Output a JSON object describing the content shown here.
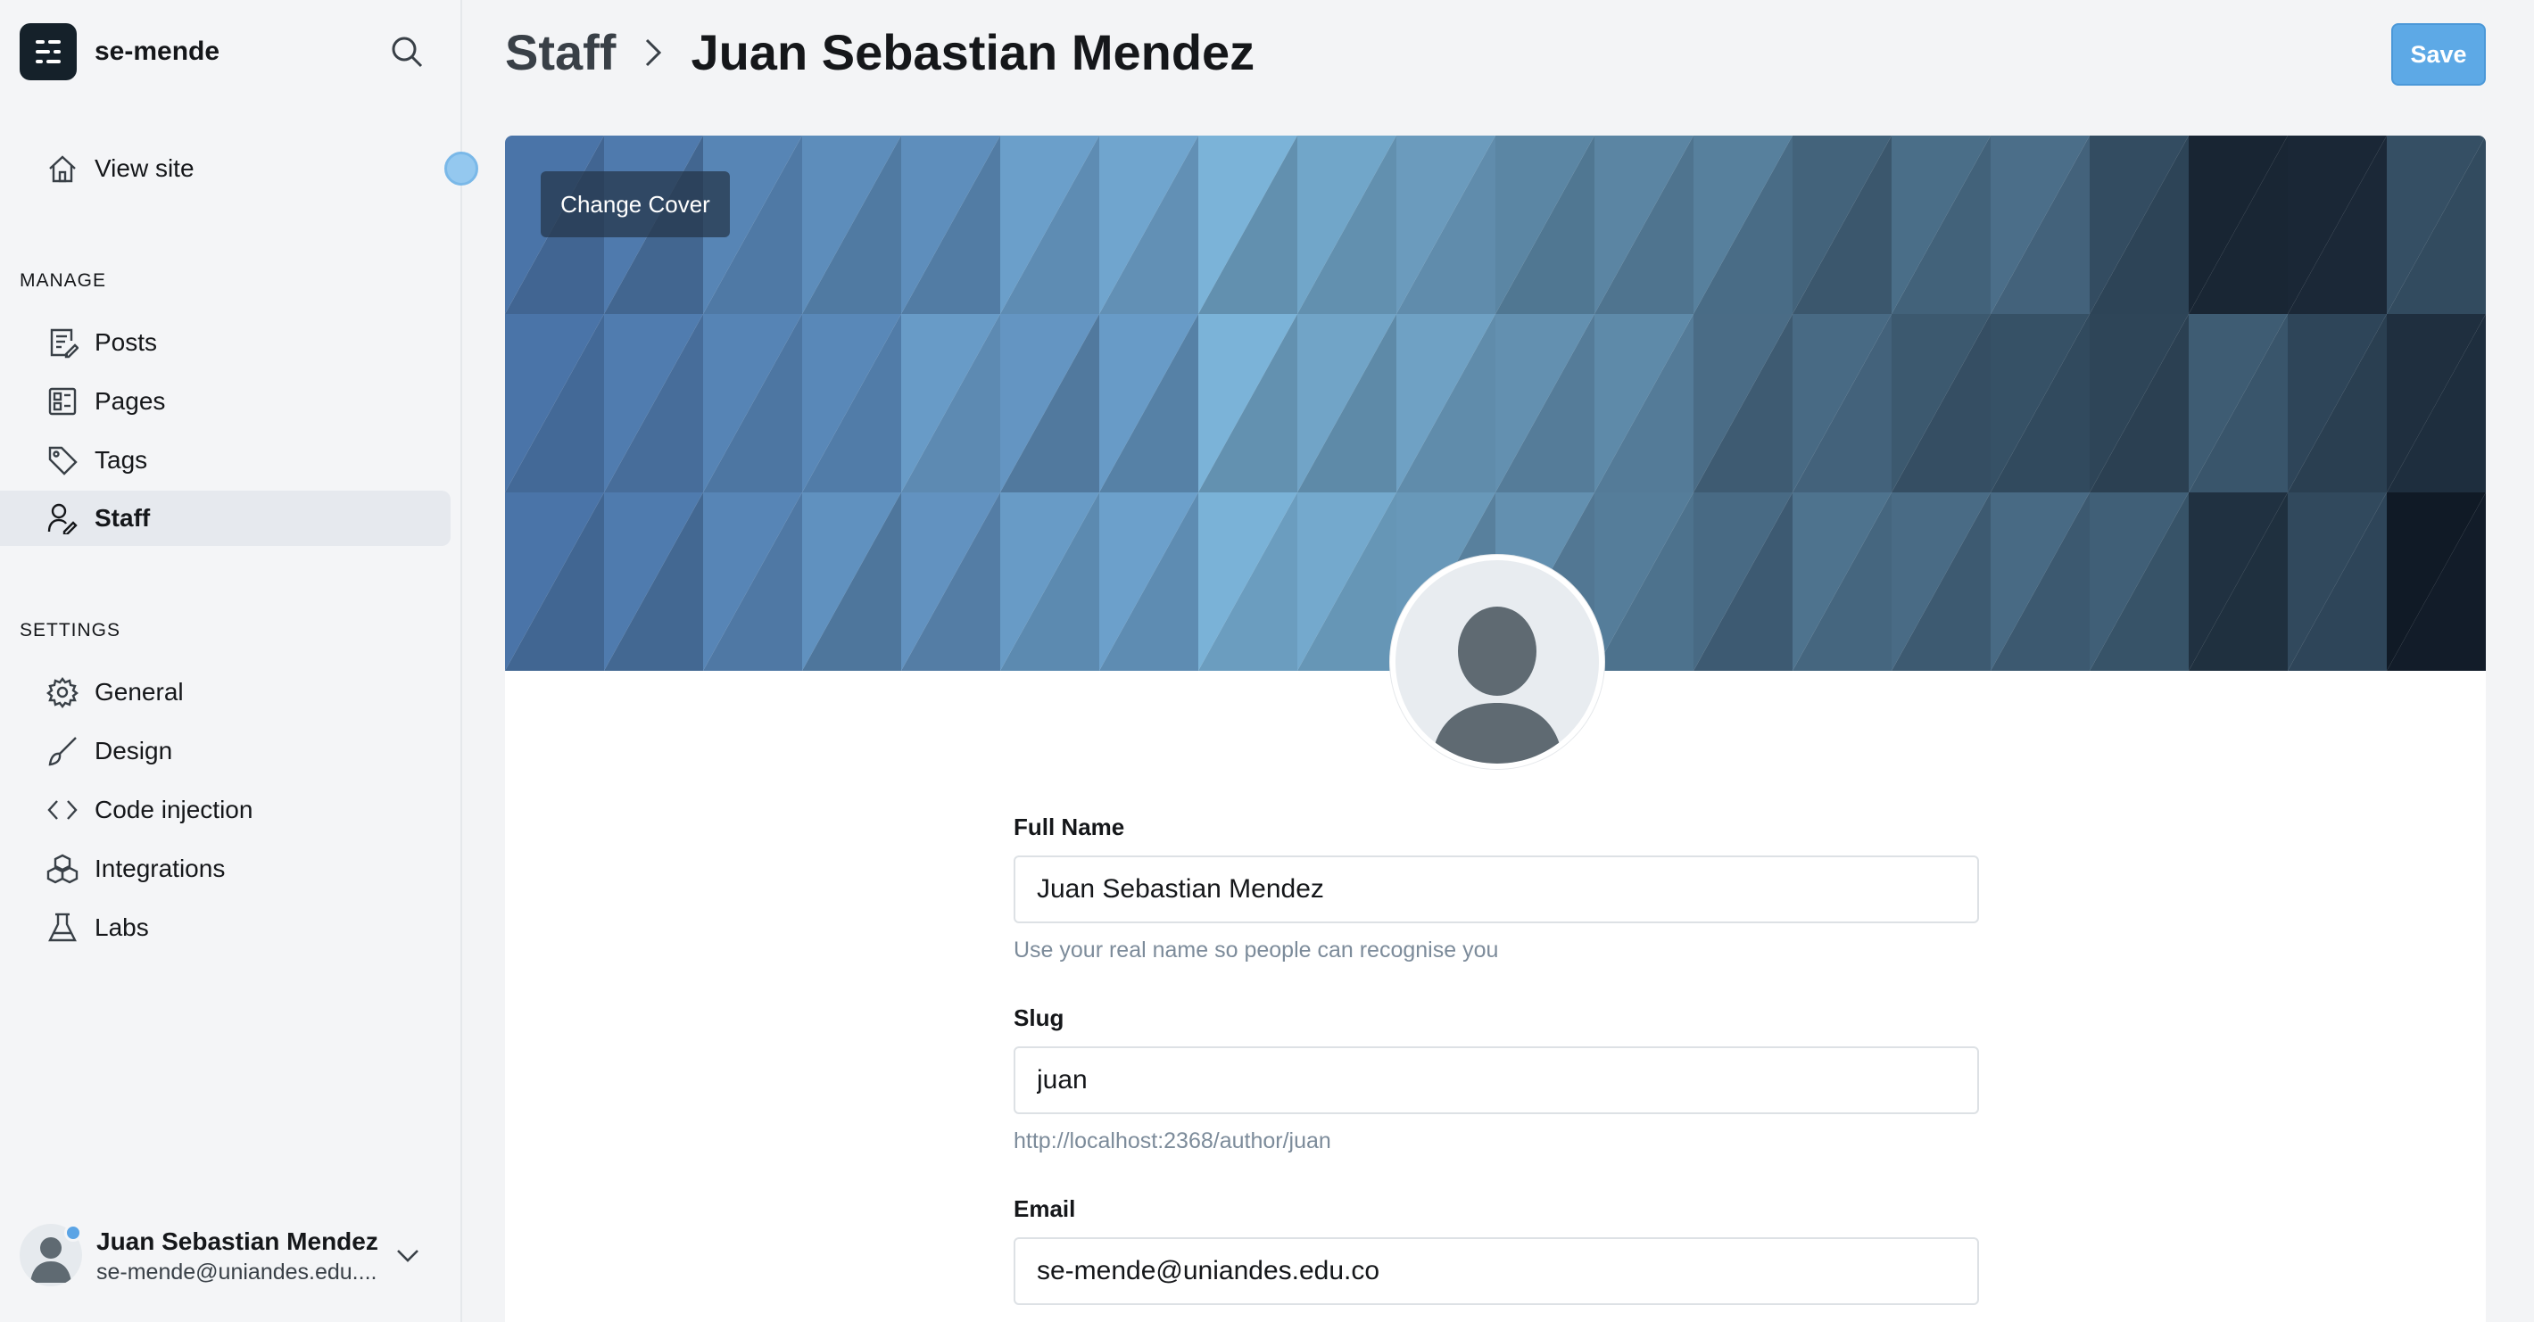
{
  "site": {
    "name": "se-mende"
  },
  "nav": {
    "view_site": "View site",
    "manage_label": "MANAGE",
    "manage_items": [
      {
        "label": "Posts",
        "icon": "posts-icon"
      },
      {
        "label": "Pages",
        "icon": "pages-icon"
      },
      {
        "label": "Tags",
        "icon": "tag-icon"
      },
      {
        "label": "Staff",
        "icon": "staff-icon",
        "active": true
      }
    ],
    "settings_label": "SETTINGS",
    "settings_items": [
      {
        "label": "General",
        "icon": "gear-icon"
      },
      {
        "label": "Design",
        "icon": "brush-icon"
      },
      {
        "label": "Code injection",
        "icon": "code-icon"
      },
      {
        "label": "Integrations",
        "icon": "integrations-icon"
      },
      {
        "label": "Labs",
        "icon": "flask-icon"
      }
    ]
  },
  "user": {
    "name": "Juan Sebastian Mendez",
    "email": "se-mende@uniandes.edu...."
  },
  "header": {
    "parent": "Staff",
    "current": "Juan Sebastian Mendez",
    "save_label": "Save"
  },
  "cover": {
    "change_label": "Change Cover"
  },
  "form": {
    "full_name": {
      "label": "Full Name",
      "value": "Juan Sebastian Mendez",
      "hint": "Use your real name so people can recognise you"
    },
    "slug": {
      "label": "Slug",
      "value": "juan",
      "hint": "http://localhost:2368/author/juan"
    },
    "email": {
      "label": "Email",
      "value": "se-mende@uniandes.edu.co"
    }
  },
  "colors": {
    "accent": "#5da9e6",
    "sidebar_bg": "#f4f5f7",
    "cover_dark": "#1c2b3a",
    "cover_light": "#7db6dc"
  }
}
